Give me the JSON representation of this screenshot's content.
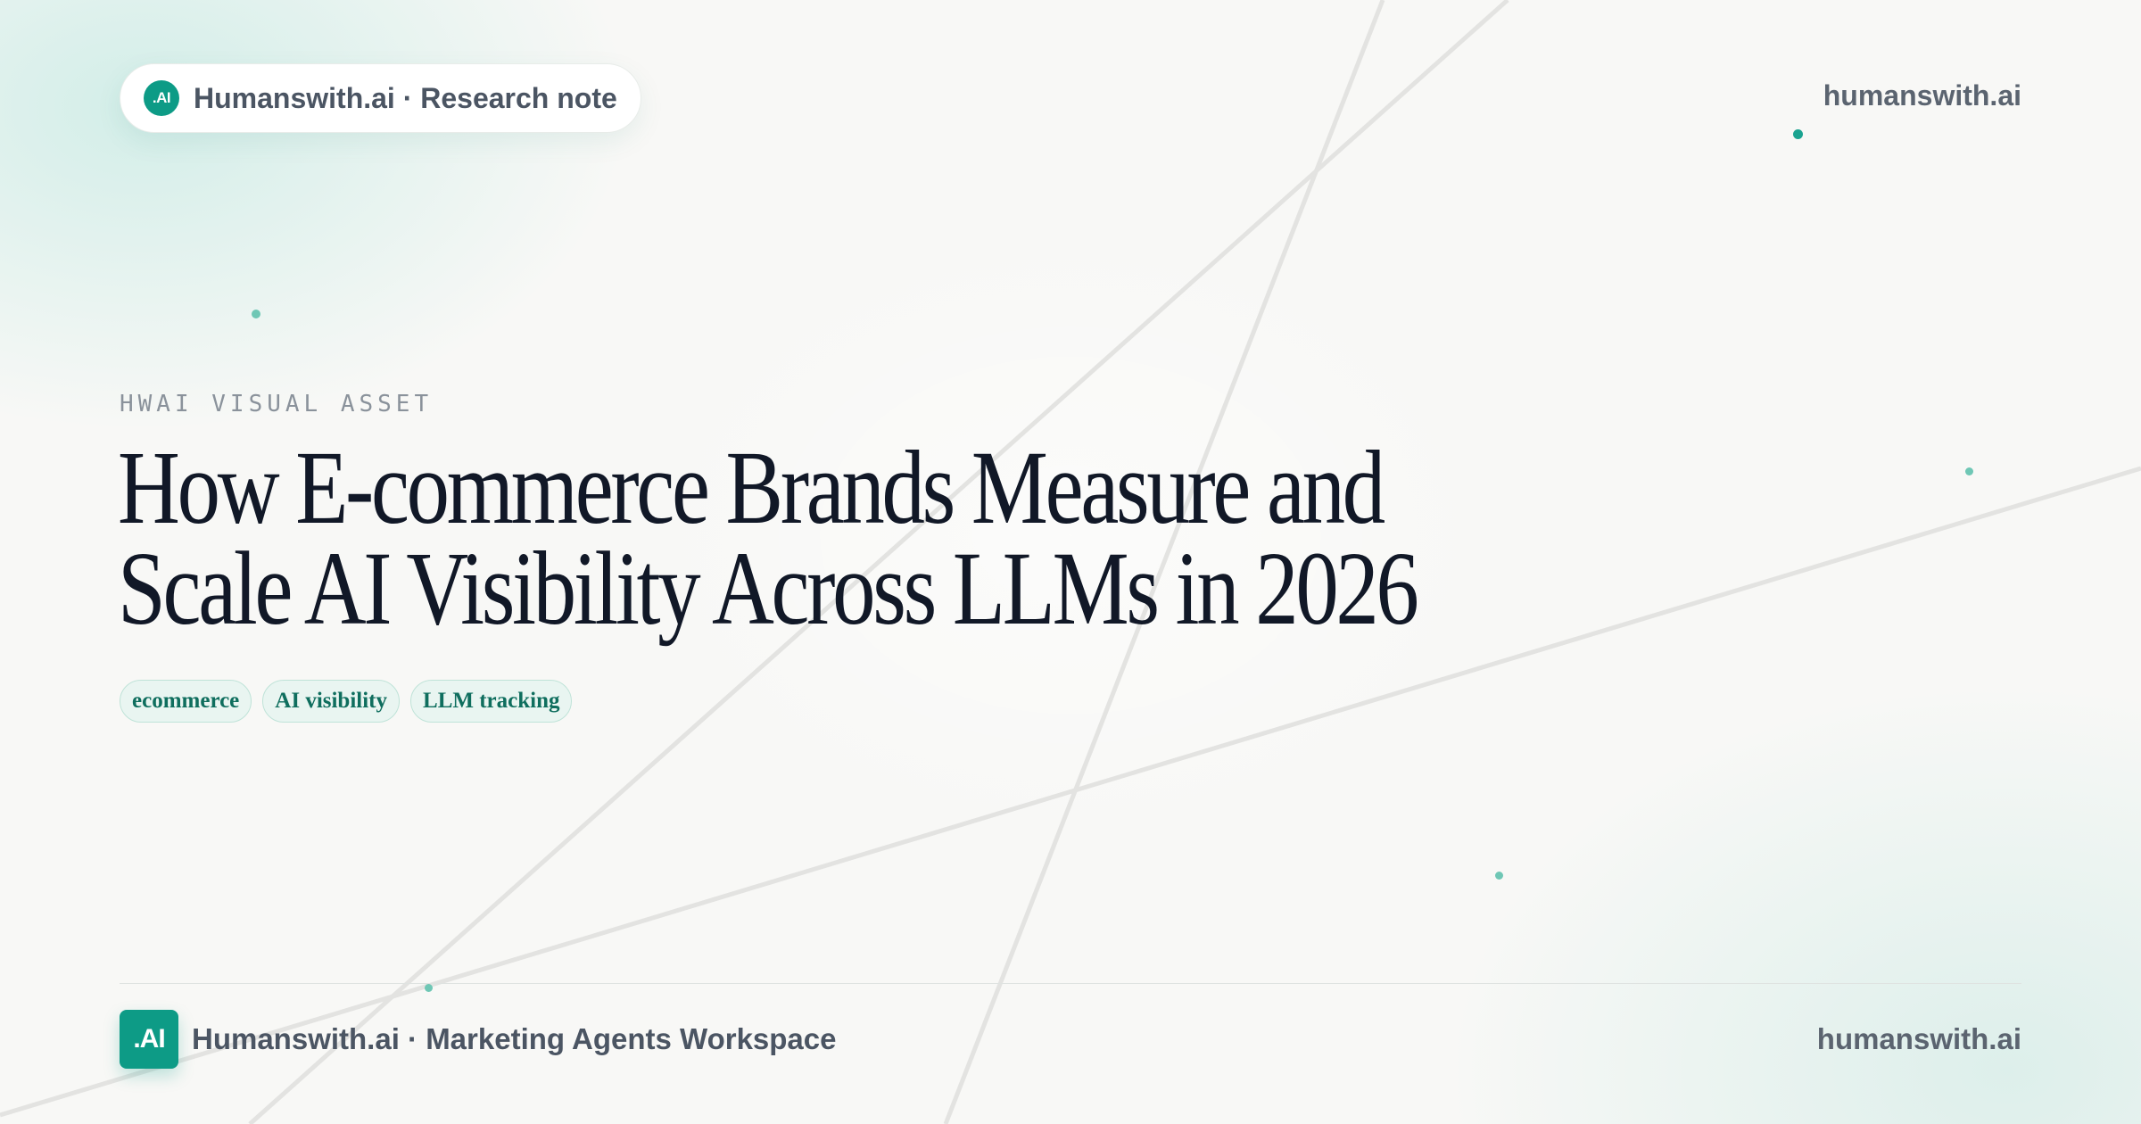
{
  "header": {
    "logo_text": ".AI",
    "pill_text": "Humanswith.ai · Research note",
    "site": "humanswith.ai"
  },
  "hero": {
    "eyebrow": "HWAI VISUAL ASSET",
    "title_lines": [
      "How E-commerce Brands Measure and",
      "Scale AI Visibility Across LLMs in 2026"
    ],
    "tags": [
      "ecommerce",
      "AI visibility",
      "LLM tracking"
    ]
  },
  "footer": {
    "logo_text": ".AI",
    "workspace": "Humanswith.ai · Marketing Agents Workspace",
    "site": "humanswith.ai"
  },
  "colors": {
    "brand": "#0d9b86",
    "title": "#111827",
    "tag_bg": "#e9f5f1",
    "tag_text": "#0f6e5e"
  }
}
